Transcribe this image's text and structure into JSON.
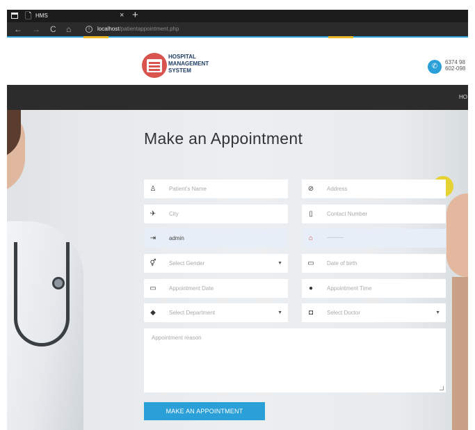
{
  "browser": {
    "tab_title": "HMS",
    "tab_close": "×",
    "new_tab": "+",
    "url_host": "localhost",
    "url_path": "/patientappointment.php",
    "back_icon": "←",
    "forward_icon": "→",
    "reload_icon": "C",
    "home_icon": "⌂",
    "info_icon": "i"
  },
  "header": {
    "logo_line1": "HOSPITAL",
    "logo_line2": "MANAGEMENT",
    "logo_line3": "SYSTEM",
    "phone_icon": "✆",
    "phone1": "6374 98",
    "phone2": "602-098"
  },
  "navbar": {
    "home_label": "HO"
  },
  "form": {
    "title": "Make an Appointment",
    "fields": {
      "patient_name": {
        "icon": "♙",
        "placeholder": "Patient's Name",
        "value": ""
      },
      "address": {
        "icon": "⊘",
        "placeholder": "Address",
        "value": ""
      },
      "city": {
        "icon": "✈",
        "placeholder": "City",
        "value": ""
      },
      "contact": {
        "icon": "▯",
        "placeholder": "Contact Number",
        "value": ""
      },
      "username": {
        "icon": "⇥",
        "placeholder": "",
        "value": "admin"
      },
      "password": {
        "icon": "⌂",
        "placeholder": "",
        "value": "············"
      },
      "gender": {
        "icon": "⚥",
        "placeholder": "Select Gender",
        "caret": "▼"
      },
      "dob": {
        "icon": "▭",
        "placeholder": "Date of birth",
        "value": ""
      },
      "appointment_date": {
        "icon": "▭",
        "placeholder": "Appointment Date",
        "value": ""
      },
      "appointment_time": {
        "icon": "●",
        "placeholder": "Appointment Time",
        "value": ""
      },
      "department": {
        "icon": "◆",
        "placeholder": "Select Department",
        "caret": "▼"
      },
      "doctor": {
        "icon": "◘",
        "placeholder": "Select Doctor",
        "caret": "▼"
      }
    },
    "reason_placeholder": "Appointment reason",
    "submit_label": "MAKE AN APPOINTMENT"
  },
  "colors": {
    "accent": "#2b9fd8",
    "logo_red": "#d9534f",
    "navbar": "#2c2c2c"
  }
}
